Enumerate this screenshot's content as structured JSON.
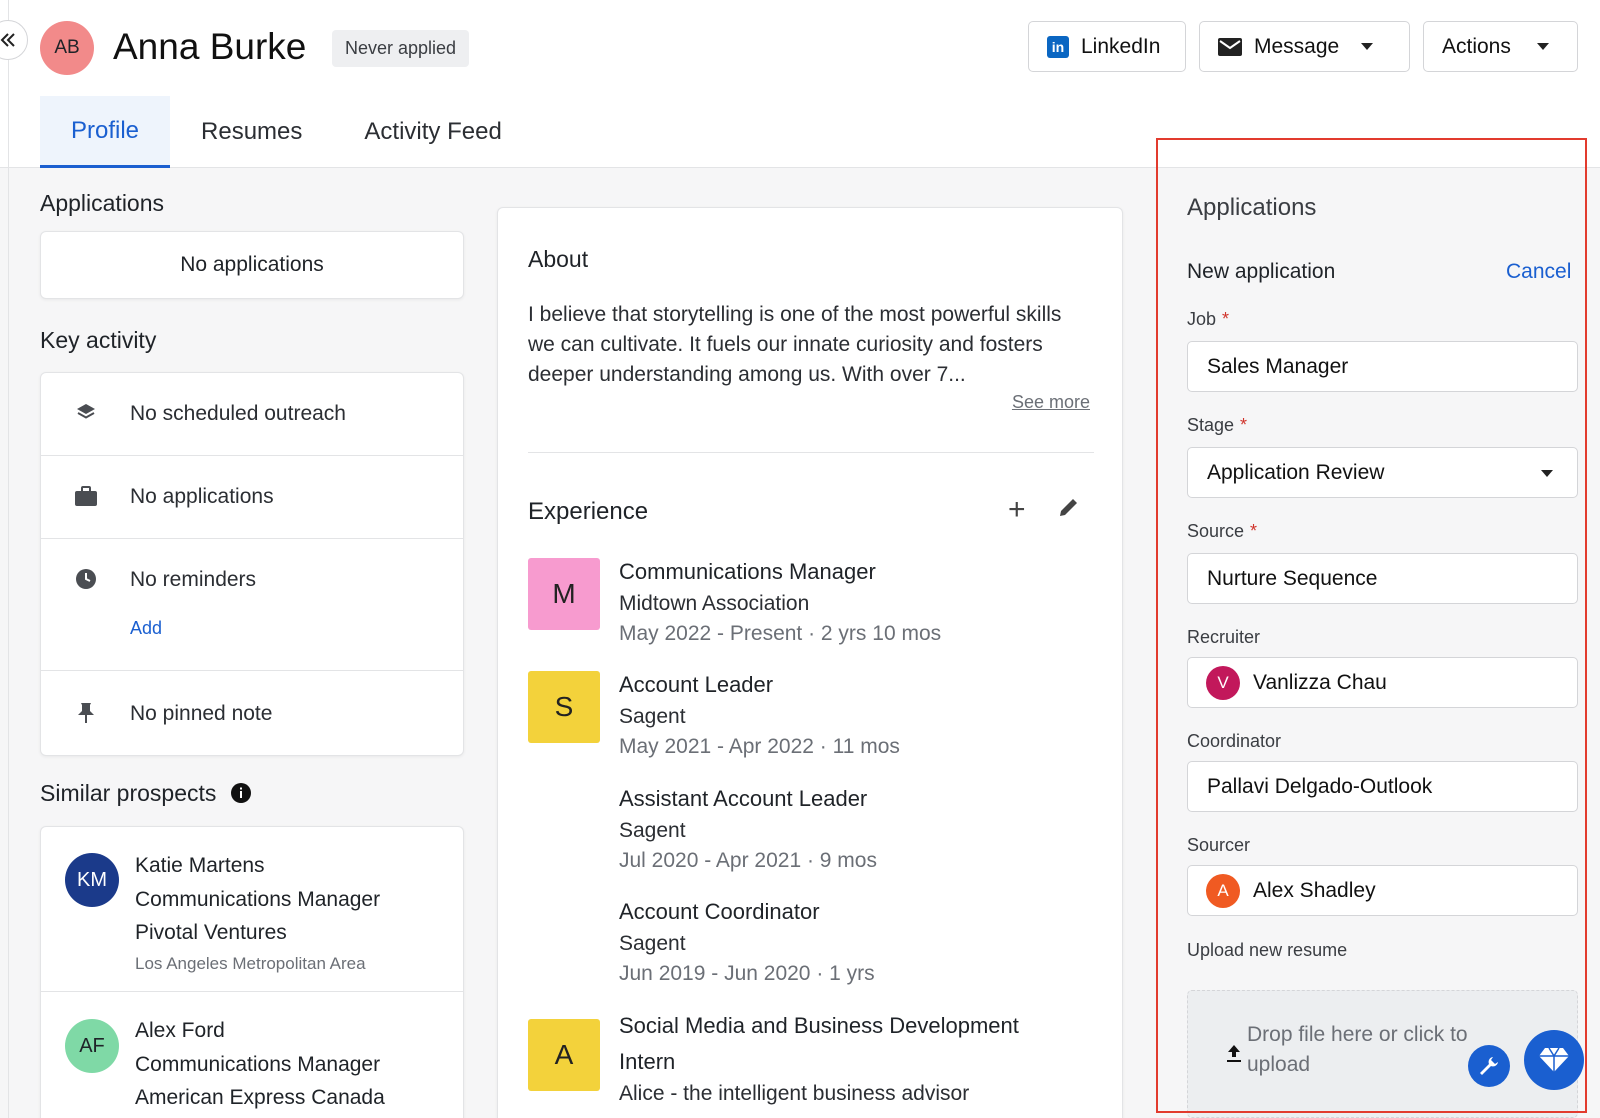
{
  "header": {
    "avatar_initials": "AB",
    "candidate_name": "Anna Burke",
    "status_badge": "Never applied",
    "buttons": {
      "linkedin": "LinkedIn",
      "message": "Message",
      "actions": "Actions"
    }
  },
  "tabs": [
    {
      "label": "Profile",
      "active": true
    },
    {
      "label": "Resumes",
      "active": false
    },
    {
      "label": "Activity Feed",
      "active": false
    }
  ],
  "left": {
    "applications_title": "Applications",
    "applications_empty": "No applications",
    "key_activity_title": "Key activity",
    "key_activity": [
      {
        "icon": "layers-icon",
        "text": "No scheduled outreach"
      },
      {
        "icon": "briefcase-icon",
        "text": "No applications"
      },
      {
        "icon": "clock-icon",
        "text": "No reminders",
        "link": "Add"
      },
      {
        "icon": "pin-icon",
        "text": "No pinned note"
      }
    ],
    "similar_title": "Similar prospects",
    "similar": [
      {
        "initials": "KM",
        "avatar_color": "#1b3a8a",
        "name": "Katie Martens",
        "title": "Communications Manager",
        "company": "Pivotal Ventures",
        "location": "Los Angeles Metropolitan Area"
      },
      {
        "initials": "AF",
        "avatar_color": "#7fd9a6",
        "name": "Alex Ford",
        "title": "Communications Manager",
        "company": "American Express Canada",
        "location": ""
      }
    ]
  },
  "about": {
    "title": "About",
    "text": "I believe that storytelling is one of the most powerful skills we can cultivate. It fuels our innate curiosity and fosters deeper understanding among us. With over 7...",
    "see_more": "See more"
  },
  "experience": {
    "title": "Experience",
    "items": [
      {
        "logo": "M",
        "logo_color": "#f79bcf",
        "title": "Communications Manager",
        "company": "Midtown Association",
        "dates": "May 2022 - Present · 2 yrs 10 mos"
      },
      {
        "logo": "S",
        "logo_color": "#f3d23b",
        "title": "Account Leader",
        "company": "Sagent",
        "dates": "May 2021 - Apr 2022 · 11 mos"
      },
      {
        "logo": "",
        "logo_color": "",
        "title": "Assistant Account Leader",
        "company": "Sagent",
        "dates": "Jul 2020 - Apr 2021 · 9 mos"
      },
      {
        "logo": "",
        "logo_color": "",
        "title": "Account Coordinator",
        "company": "Sagent",
        "dates": "Jun 2019 - Jun 2020 · 1 yrs"
      },
      {
        "logo": "A",
        "logo_color": "#f3d23b",
        "title": "Social Media and Business Development",
        "title2": "Intern",
        "company": "Alice - the intelligent business advisor",
        "dates": ""
      }
    ]
  },
  "application_form": {
    "title": "Applications",
    "subtitle": "New application",
    "cancel": "Cancel",
    "job_label": "Job",
    "job_value": "Sales Manager",
    "stage_label": "Stage",
    "stage_value": "Application Review",
    "source_label": "Source",
    "source_value": "Nurture Sequence",
    "recruiter_label": "Recruiter",
    "recruiter_initial": "V",
    "recruiter_color": "#c2185b",
    "recruiter_value": "Vanlizza Chau",
    "coordinator_label": "Coordinator",
    "coordinator_value": "Pallavi Delgado-Outlook",
    "sourcer_label": "Sourcer",
    "sourcer_initial": "A",
    "sourcer_color": "#f05a22",
    "sourcer_value": "Alex Shadley",
    "upload_label": "Upload new resume",
    "upload_text": "Drop file here or click to upload",
    "required_mark": "*"
  },
  "colors": {
    "accent": "#1a5fd0",
    "highlight": "#e23b2e",
    "avatar_main": "#f28a8a"
  }
}
